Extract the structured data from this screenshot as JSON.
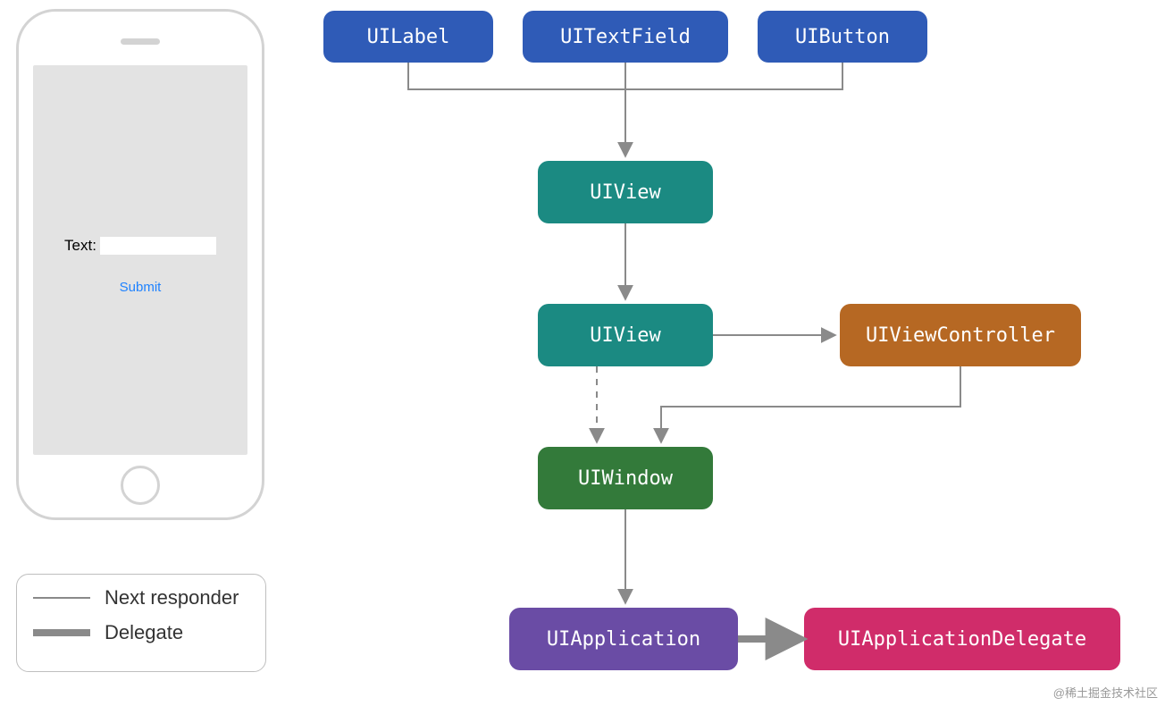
{
  "phone": {
    "label": "Text:",
    "submit": "Submit"
  },
  "legend": {
    "next_responder": "Next responder",
    "delegate": "Delegate"
  },
  "nodes": {
    "uilabel": "UILabel",
    "uitextfield": "UITextField",
    "uibutton": "UIButton",
    "uiview1": "UIView",
    "uiview2": "UIView",
    "uiviewcontroller": "UIViewController",
    "uiwindow": "UIWindow",
    "uiapplication": "UIApplication",
    "uiapplicationdelegate": "UIApplicationDelegate"
  },
  "colors": {
    "blue": "#2f5bb7",
    "teal": "#1b8a82",
    "green": "#337a3a",
    "purple": "#6a4ca5",
    "pink": "#d02c6a",
    "brown": "#b66823",
    "arrow": "#8a8a8a"
  },
  "edges": [
    {
      "from": "UILabel",
      "to": "UIView",
      "type": "next_responder"
    },
    {
      "from": "UITextField",
      "to": "UIView",
      "type": "next_responder"
    },
    {
      "from": "UIButton",
      "to": "UIView",
      "type": "next_responder"
    },
    {
      "from": "UIView",
      "to": "UIView",
      "type": "next_responder"
    },
    {
      "from": "UIView",
      "to": "UIViewController",
      "type": "next_responder"
    },
    {
      "from": "UIView",
      "to": "UIWindow",
      "type": "next_responder",
      "dashed": true
    },
    {
      "from": "UIViewController",
      "to": "UIWindow",
      "type": "next_responder"
    },
    {
      "from": "UIWindow",
      "to": "UIApplication",
      "type": "next_responder"
    },
    {
      "from": "UIApplication",
      "to": "UIApplicationDelegate",
      "type": "delegate"
    }
  ],
  "watermark": "@稀土掘金技术社区"
}
